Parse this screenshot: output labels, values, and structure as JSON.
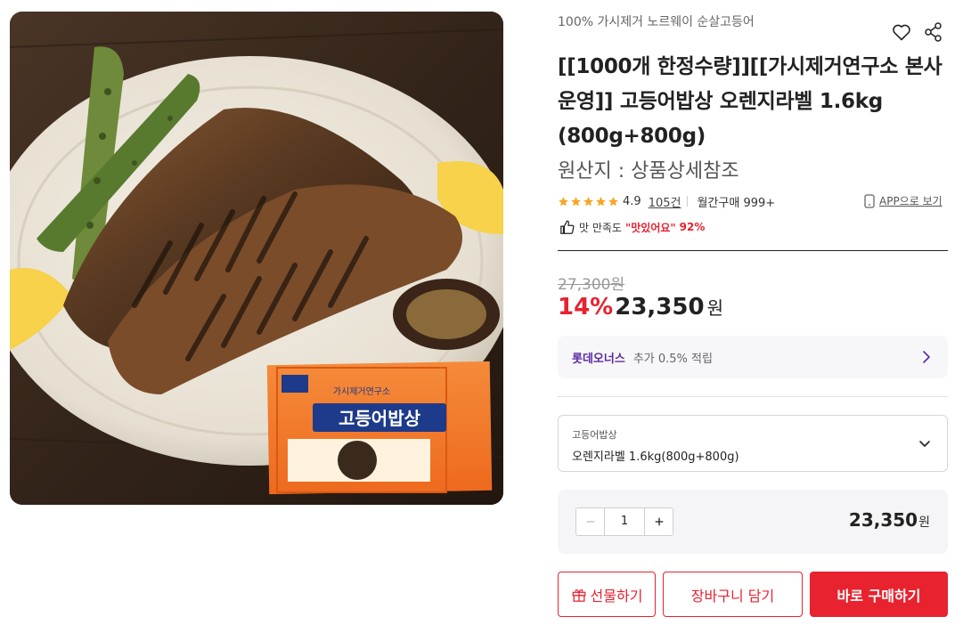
{
  "product": {
    "brand": "100% 가시제거 노르웨이 순살고등어",
    "title": "[[1000개 한정수량]][[가시제거연구소 본사운영]] 고등어밥상 오렌지라벨 1.6kg (800g+800g)",
    "origin": "원산지 : 상품상세참조",
    "image_alt": "고등어밥상 product photo",
    "package_text": "고등어밥상",
    "package_brand": "가시제거연구소"
  },
  "rating": {
    "score": "4.9",
    "stars": 5,
    "review_count": "105건",
    "monthly_purchase": "월간구매 999+"
  },
  "app_link": "APP으로 보기",
  "taste": {
    "label": "맛 만족도",
    "highlight": "\"맛있어요\"",
    "percent": "92%"
  },
  "price": {
    "original": "27,300원",
    "discount": "14%",
    "sale": "23,350",
    "currency": "원"
  },
  "benefit": {
    "brand": "롯데오너스",
    "text": "추가 0.5% 적립"
  },
  "option": {
    "group": "고등어밥상",
    "value": "오렌지라벨 1.6kg(800g+800g)"
  },
  "quantity": {
    "value": "1",
    "total": "23,350",
    "currency": "원"
  },
  "buttons": {
    "gift": "선물하기",
    "cart": "장바구니 담기",
    "buy": "바로 구매하기"
  },
  "colors": {
    "accent": "#e8222f",
    "benefit_brand": "#5b2aa3",
    "star": "#f5a623"
  }
}
